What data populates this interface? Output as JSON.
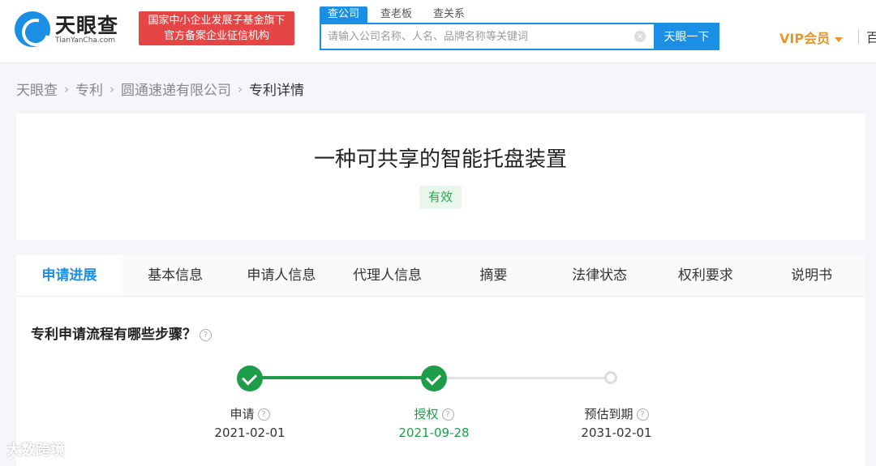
{
  "header": {
    "logo_cn": "天眼查",
    "logo_en": "TianYanCha.com",
    "badge_line1": "国家中小企业发展子基金旗下",
    "badge_line2": "官方备案企业征信机构",
    "search_tabs": [
      {
        "label": "查公司"
      },
      {
        "label": "查老板"
      },
      {
        "label": "查关系"
      }
    ],
    "search_placeholder": "请输入公司名称、人名、品牌名称等关键词",
    "search_button": "天眼一下",
    "vip_label": "VIP会员",
    "more_label": "百"
  },
  "breadcrumb": [
    {
      "label": "天眼查"
    },
    {
      "label": "专利"
    },
    {
      "label": "圆通速递有限公司"
    },
    {
      "label": "专利详情"
    }
  ],
  "patent": {
    "title": "一种可共享的智能托盘装置",
    "status": "有效"
  },
  "tabs": [
    {
      "label": "申请进展"
    },
    {
      "label": "基本信息"
    },
    {
      "label": "申请人信息"
    },
    {
      "label": "代理人信息"
    },
    {
      "label": "摘要"
    },
    {
      "label": "法律状态"
    },
    {
      "label": "权利要求"
    },
    {
      "label": "说明书"
    }
  ],
  "progress": {
    "section_title": "专利申请流程有哪些步骤？",
    "steps": [
      {
        "label": "申请",
        "date": "2021-02-01"
      },
      {
        "label": "授权",
        "date": "2021-09-28"
      },
      {
        "label": "预估到期",
        "date": "2031-02-01"
      }
    ]
  },
  "watermark": "大数跨境",
  "colors": {
    "brand_blue": "#1a8fe3",
    "success_green": "#1d9d4a",
    "badge_red": "#e64545",
    "vip_orange": "#e8962b"
  }
}
